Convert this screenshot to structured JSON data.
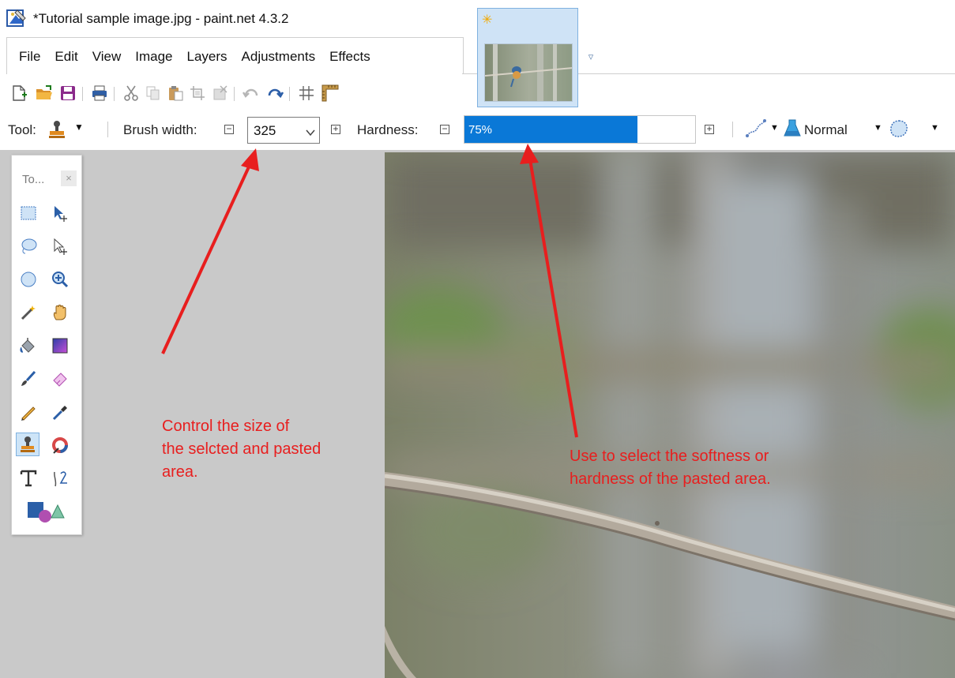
{
  "window": {
    "title": "*Tutorial sample image.jpg - paint.net 4.3.2"
  },
  "menu": {
    "items": [
      "File",
      "Edit",
      "View",
      "Image",
      "Layers",
      "Adjustments",
      "Effects"
    ]
  },
  "toolbar": {
    "icons": [
      "new-icon",
      "open-icon",
      "save-icon",
      "print-icon",
      "cut-icon",
      "copy-icon",
      "paste-icon",
      "crop-to-selection-icon",
      "deselect-icon",
      "undo-icon",
      "redo-icon",
      "grid-icon",
      "ruler-icon"
    ]
  },
  "tool_options": {
    "tool_label": "Tool:",
    "brush_width_label": "Brush width:",
    "brush_width_value": "325",
    "hardness_label": "Hardness:",
    "hardness_value": "75%",
    "hardness_percent": 75,
    "blend_mode": "Normal"
  },
  "tools_window": {
    "title": "To...",
    "close": "×"
  },
  "annotations": {
    "left_note": [
      "Control the size of",
      "the selcted and pasted",
      "area."
    ],
    "right_note": [
      "Use to select the softness or",
      "hardness of the pasted area."
    ],
    "color": "#e81e1e"
  },
  "colors": {
    "accent": "#0a78d7",
    "workspace": "#c9c9c9",
    "tab_selected": "#cfe3f6"
  }
}
